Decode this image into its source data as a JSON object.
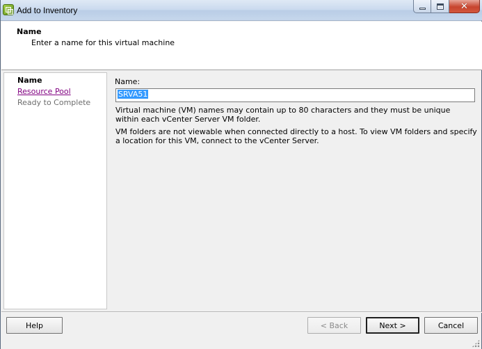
{
  "window": {
    "title": "Add to Inventory",
    "close_glyph": "✕"
  },
  "header": {
    "title": "Name",
    "subtitle": "Enter a name for this virtual machine"
  },
  "steps": [
    {
      "label": "Name",
      "state": "current"
    },
    {
      "label": "Resource Pool",
      "state": "link"
    },
    {
      "label": "Ready to Complete",
      "state": "disabled"
    }
  ],
  "form": {
    "name_label": "Name:",
    "name_value": "SRVA51",
    "info_1": "Virtual machine (VM) names may contain up to 80 characters and they must be unique within each vCenter Server VM folder.",
    "info_2": "VM folders are not viewable when connected directly to a host. To view VM folders and specify a location for this VM, connect to the vCenter Server."
  },
  "buttons": {
    "help": "Help",
    "back": "< Back",
    "next": "Next >",
    "cancel": "Cancel"
  },
  "colors": {
    "link_visited": "#800080",
    "selection": "#3399ff",
    "close_button": "#c7452f"
  },
  "icons": [
    "app-icon",
    "minimize-icon",
    "maximize-icon",
    "close-icon",
    "resize-grip-icon"
  ]
}
